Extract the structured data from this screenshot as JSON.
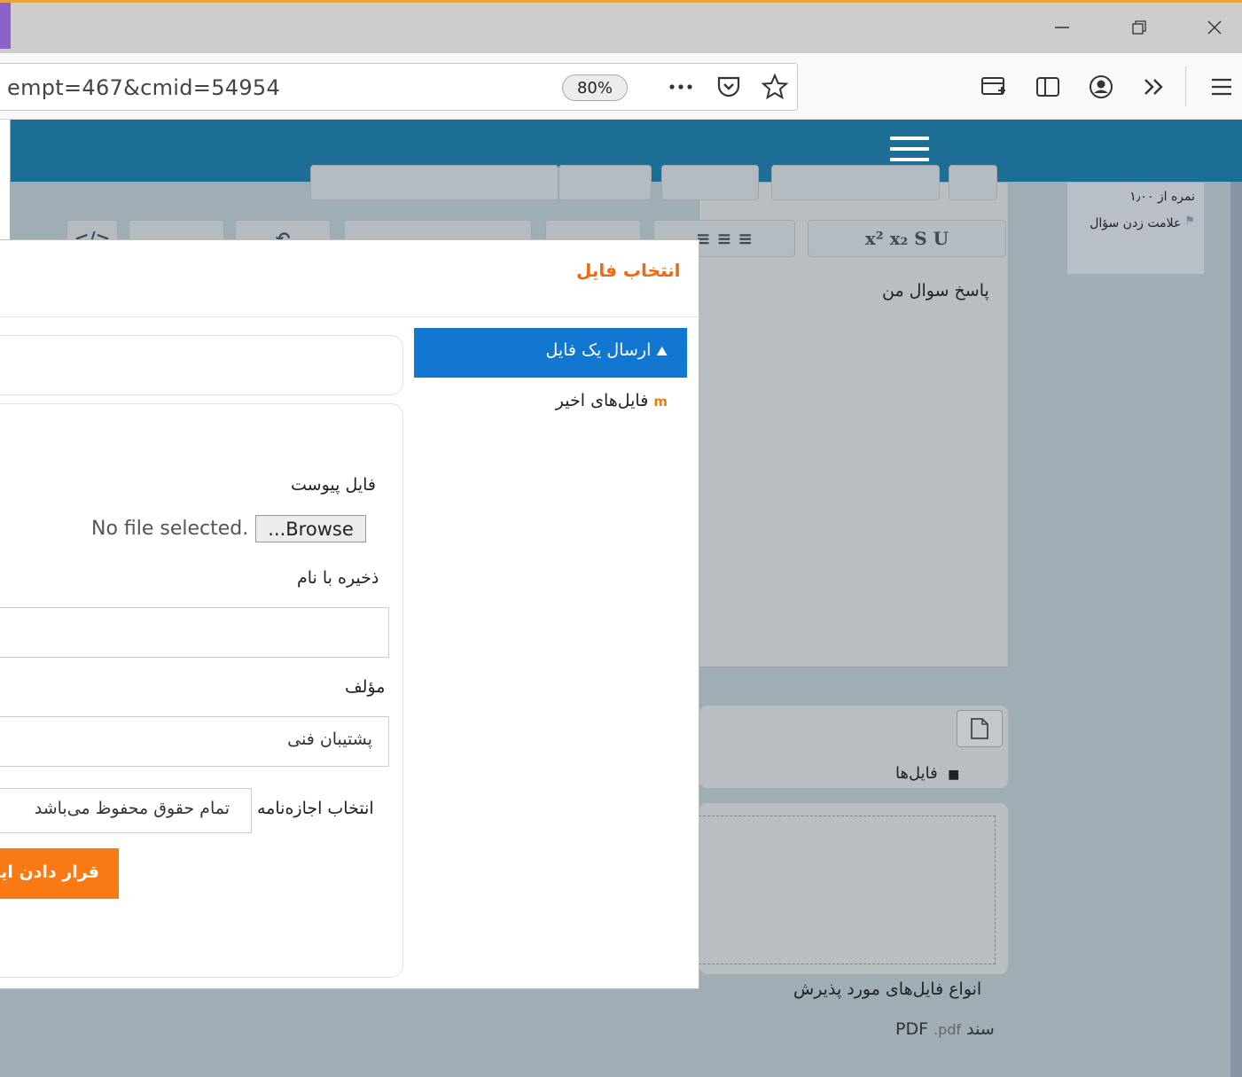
{
  "browser": {
    "url_fragment": "empt=467&cmid=54954",
    "zoom": "80%",
    "minimize_icon": "minimize-icon",
    "restore_icon": "restore-icon",
    "close_icon": "close-icon"
  },
  "question_info": {
    "grade": "نمره از ۱٫۰۰",
    "flag": "علامت زدن سؤال"
  },
  "editor": {
    "answer_label": "پاسخ سوال من"
  },
  "files": {
    "label": "فایل‌ها",
    "accepted_title": "انواع فایل‌های مورد پذیرش",
    "accepted_type": "سند PDF",
    "accepted_ext": ".pdf"
  },
  "modal": {
    "title": "انتخاب فایل",
    "nav_upload": "ارسال یک فایل",
    "nav_recent": "فایل‌های اخیر",
    "attachment_label": "فایل پیوست",
    "no_file": "No file selected.",
    "browse": "...Browse",
    "save_as_label": "ذخیره با نام",
    "save_as_value": "",
    "author_label": "مؤلف",
    "author_value": "پشتیبان فنی",
    "license_label": "انتخاب اجازه‌نامه",
    "license_value": "تمام حقوق محفوظ می‌باشد",
    "upload_button": "قرار دادن این فایل"
  },
  "colors": {
    "header": "#1c6e96",
    "nav_active": "#1177d1",
    "accent_orange": "#f97915",
    "title_orange": "#f0690e"
  }
}
